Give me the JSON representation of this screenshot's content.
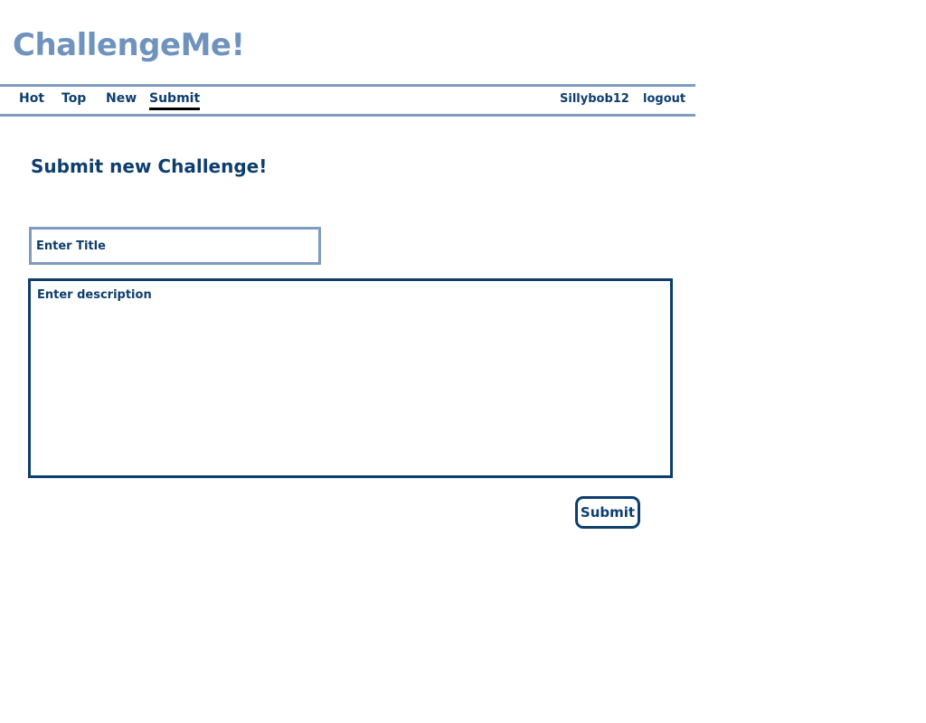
{
  "app": {
    "logo": "ChallengeMe!"
  },
  "nav": {
    "items": [
      {
        "label": "Hot"
      },
      {
        "label": "Top"
      },
      {
        "label": "New"
      },
      {
        "label": "Submit",
        "active": true
      }
    ],
    "username": "Sillybob12",
    "logout_label": "logout"
  },
  "form": {
    "heading": "Submit new Challenge!",
    "title_placeholder": "Enter Title",
    "title_value": "",
    "description_placeholder": "Enter description",
    "description_value": "",
    "submit_label": "Submit"
  },
  "colors": {
    "logo": "#7093bd",
    "text": "#0e3e6e",
    "nav_border": "#7e9cc1",
    "active_underline": "#000000"
  }
}
